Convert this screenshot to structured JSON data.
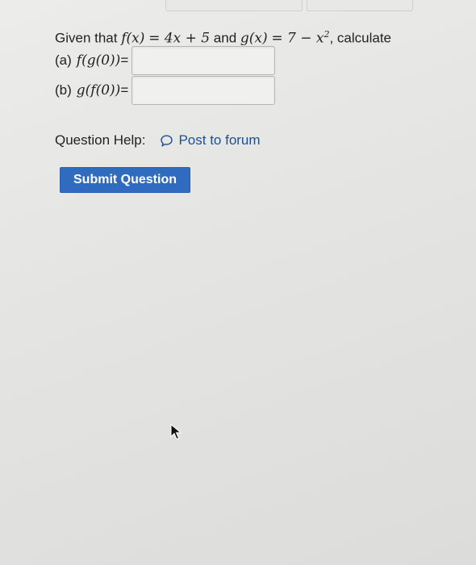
{
  "question": {
    "prefix": "Given that",
    "f_lhs": "f(x)",
    "f_rhs": "= 4x + 5",
    "conj": "and",
    "g_lhs": "g(x)",
    "g_rhs": "= 7 − x",
    "g_exp": "2",
    "suffix": ", calculate"
  },
  "parts": [
    {
      "label": "(a)",
      "expr": "f(g(0))",
      "eq": "=",
      "value": ""
    },
    {
      "label": "(b)",
      "expr": "g(f(0))",
      "eq": "=",
      "value": ""
    }
  ],
  "help": {
    "label": "Question Help:",
    "icon": "speech-bubble-icon",
    "link": "Post to forum"
  },
  "submit": {
    "label": "Submit Question"
  },
  "colors": {
    "accent": "#2f6bbf",
    "link": "#1d4f91"
  }
}
